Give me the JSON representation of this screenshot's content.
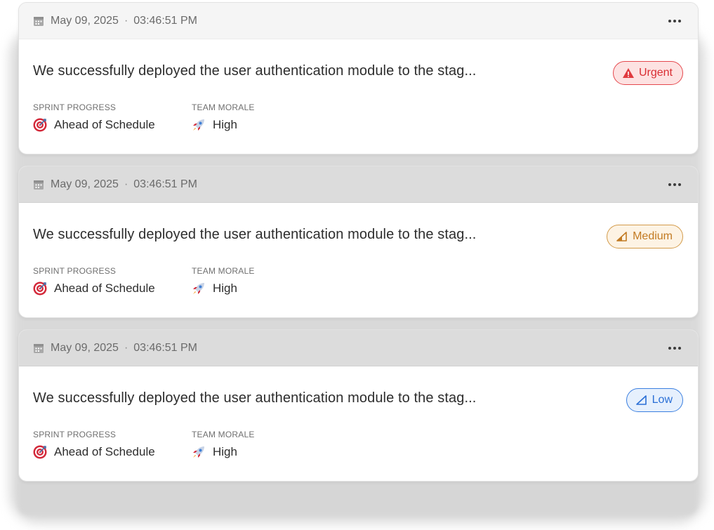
{
  "cards": [
    {
      "date": "May 09, 2025",
      "time": "03:46:51 PM",
      "summary": "We successfully deployed the user authentication module to the stag...",
      "priority": {
        "label": "Urgent",
        "level": "urgent",
        "icon": "warning-triangle-icon",
        "color": "#d92d32"
      },
      "sprint_progress_label": "SPRINT PROGRESS",
      "sprint_progress_value": "Ahead of Schedule",
      "team_morale_label": "TEAM MORALE",
      "team_morale_value": "High"
    },
    {
      "date": "May 09, 2025",
      "time": "03:46:51 PM",
      "summary": "We successfully deployed the user authentication module to the stag...",
      "priority": {
        "label": "Medium",
        "level": "medium",
        "icon": "signal-medium-icon",
        "color": "#c27a22"
      },
      "sprint_progress_label": "SPRINT PROGRESS",
      "sprint_progress_value": "Ahead of Schedule",
      "team_morale_label": "TEAM MORALE",
      "team_morale_value": "High"
    },
    {
      "date": "May 09, 2025",
      "time": "03:46:51 PM",
      "summary": "We successfully deployed the user authentication module to the stag...",
      "priority": {
        "label": "Low",
        "level": "low",
        "icon": "signal-low-icon",
        "color": "#2a6fd6"
      },
      "sprint_progress_label": "SPRINT PROGRESS",
      "sprint_progress_value": "Ahead of Schedule",
      "team_morale_label": "TEAM MORALE",
      "team_morale_value": "High"
    }
  ],
  "separator": "·"
}
